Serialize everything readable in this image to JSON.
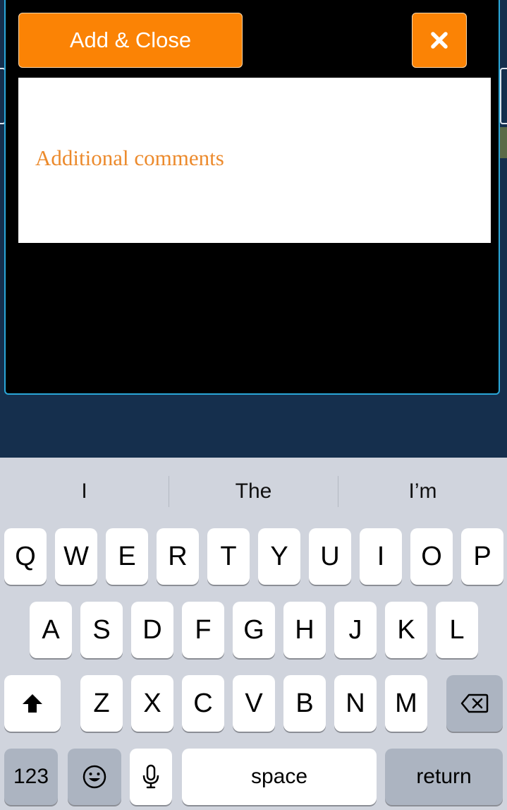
{
  "modal": {
    "add_close_label": "Add & Close",
    "close_icon": "close-icon",
    "comments_placeholder": "Additional comments",
    "comments_value": ""
  },
  "keyboard": {
    "suggestions": [
      "I",
      "The",
      "I’m"
    ],
    "row1": [
      "Q",
      "W",
      "E",
      "R",
      "T",
      "Y",
      "U",
      "I",
      "O",
      "P"
    ],
    "row2": [
      "A",
      "S",
      "D",
      "F",
      "G",
      "H",
      "J",
      "K",
      "L"
    ],
    "row3": [
      "Z",
      "X",
      "C",
      "V",
      "B",
      "N",
      "M"
    ],
    "shift_icon": "shift-icon",
    "backspace_icon": "backspace-icon",
    "numbers_label": "123",
    "emoji_icon": "emoji-icon",
    "mic_icon": "microphone-icon",
    "space_label": "space",
    "return_label": "return"
  },
  "colors": {
    "accent": "#fb8305",
    "modal_border": "#2aa7d8",
    "background": "#152f4d",
    "keyboard_bg": "#d0d4dd"
  }
}
